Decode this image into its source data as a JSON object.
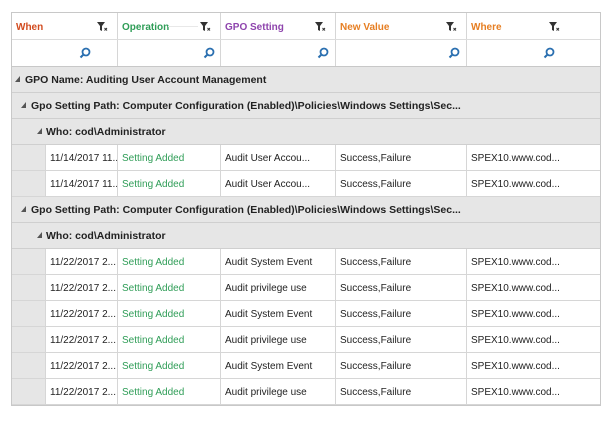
{
  "columns": [
    {
      "label": "When",
      "color": "#d24b1f"
    },
    {
      "label": "Operation",
      "color": "#2f9d57"
    },
    {
      "label": "GPO Setting",
      "color": "#8e44ad"
    },
    {
      "label": "New Value",
      "color": "#e67e22"
    },
    {
      "label": "Where",
      "color": "#e67e22"
    }
  ],
  "icons": {
    "filter": "filter-funnel-icon",
    "search": "magnifier-icon",
    "collapse": "collapse-triangle-icon"
  },
  "groups": {
    "gpo": "GPO Name: Auditing User Account Management",
    "path1": "Gpo Setting Path: Computer Configuration (Enabled)\\Policies\\Windows Settings\\Sec...",
    "who1": "Who: cod\\Administrator",
    "path2": "Gpo Setting Path: Computer Configuration (Enabled)\\Policies\\Windows Settings\\Sec...",
    "who2": "Who: cod\\Administrator"
  },
  "rows1": [
    {
      "when": "11/14/2017 11...",
      "operation": "Setting Added",
      "setting": "Audit User Accou...",
      "value": "Success,Failure",
      "where": "SPEX10.www.cod..."
    },
    {
      "when": "11/14/2017 11...",
      "operation": "Setting Added",
      "setting": "Audit User Accou...",
      "value": "Success,Failure",
      "where": "SPEX10.www.cod..."
    }
  ],
  "rows2": [
    {
      "when": "11/22/2017 2...",
      "operation": "Setting Added",
      "setting": "Audit System Event",
      "value": "Success,Failure",
      "where": "SPEX10.www.cod..."
    },
    {
      "when": "11/22/2017 2...",
      "operation": "Setting Added",
      "setting": "Audit privilege use",
      "value": "Success,Failure",
      "where": "SPEX10.www.cod..."
    },
    {
      "when": "11/22/2017 2...",
      "operation": "Setting Added",
      "setting": "Audit System Event",
      "value": "Success,Failure",
      "where": "SPEX10.www.cod..."
    },
    {
      "when": "11/22/2017 2...",
      "operation": "Setting Added",
      "setting": "Audit privilege use",
      "value": "Success,Failure",
      "where": "SPEX10.www.cod..."
    },
    {
      "when": "11/22/2017 2...",
      "operation": "Setting Added",
      "setting": "Audit System Event",
      "value": "Success,Failure",
      "where": "SPEX10.www.cod..."
    },
    {
      "when": "11/22/2017 2...",
      "operation": "Setting Added",
      "setting": "Audit privilege use",
      "value": "Success,Failure",
      "where": "SPEX10.www.cod..."
    }
  ]
}
